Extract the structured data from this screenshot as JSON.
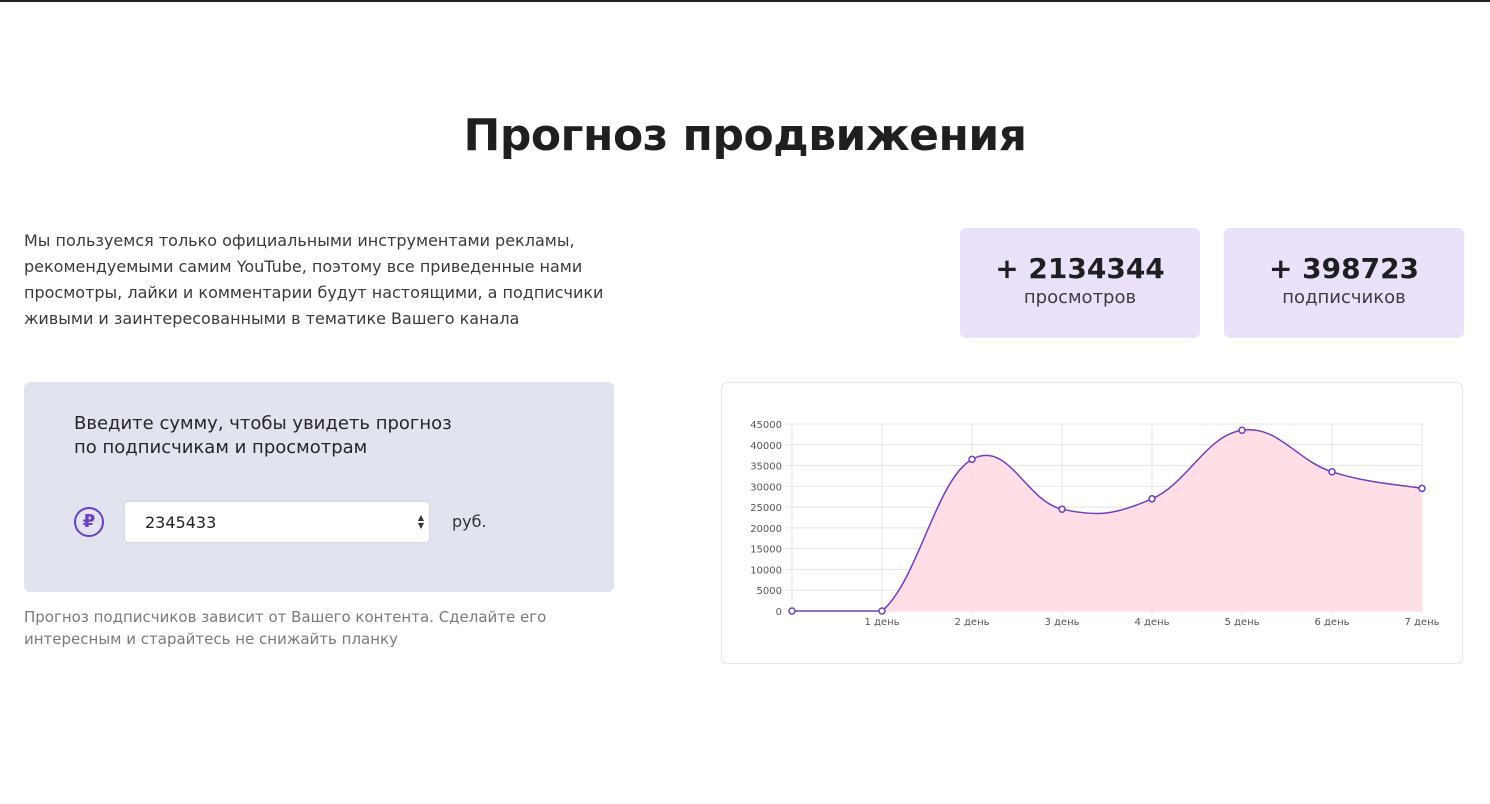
{
  "title": "Прогноз продвижения",
  "intro": "Мы пользуемся только официальными инструментами рекламы, рекомендуемыми самим YouTube, поэтому все приведенные нами просмотры, лайки и комментарии будут настоящими, а подписчики живыми и заинтересованными в тематике Вашего канала",
  "stats": [
    {
      "value": "+ 2134344",
      "label": "просмотров"
    },
    {
      "value": "+ 398723",
      "label": "подписчиков"
    }
  ],
  "calculator": {
    "prompt": "Введите сумму, чтобы увидеть прогноз по подписчикам и просмотрам",
    "currency_icon": "₽",
    "amount": "2345433",
    "unit": "руб."
  },
  "note": "Прогноз подписчиков зависит от Вашего контента. Сделайте его интересным и старайтесь не снижайть планку",
  "colors": {
    "accent": "#6b3fc8",
    "fill": "#ffdde4",
    "card": "#ebe1fb",
    "panel": "#e1e3ee"
  },
  "chart_data": {
    "type": "area",
    "categories": [
      "",
      "1 день",
      "2 день",
      "3 день",
      "4 день",
      "5 день",
      "6 день",
      "7 день"
    ],
    "values": [
      0,
      0,
      36500,
      24500,
      27000,
      43500,
      33500,
      29500
    ],
    "yticks": [
      0,
      5000,
      10000,
      15000,
      20000,
      25000,
      30000,
      35000,
      40000,
      45000
    ],
    "ylim": [
      0,
      45000
    ],
    "grid": true,
    "line_color": "#6b3fc8",
    "fill_color": "#ffdde4"
  }
}
